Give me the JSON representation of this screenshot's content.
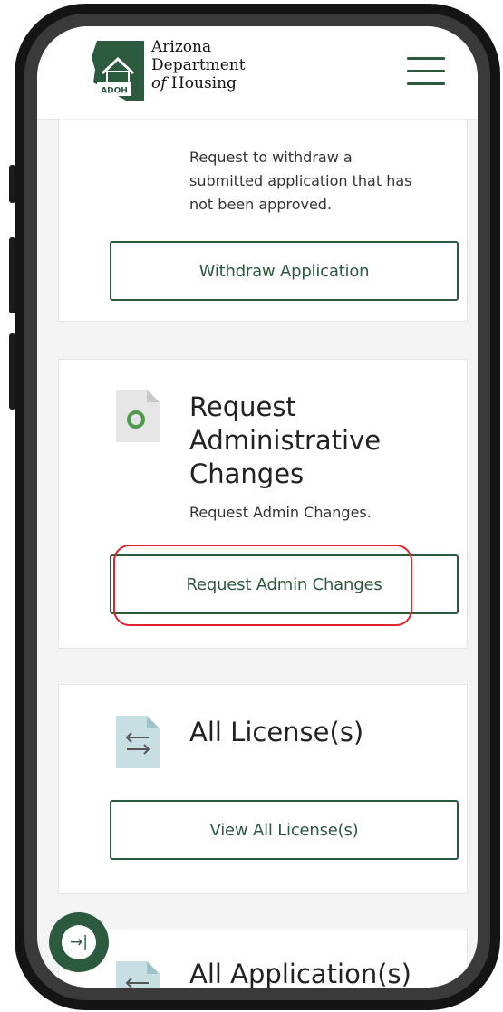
{
  "header": {
    "logo_badge": "ADOH",
    "logo_line1": "Arizona",
    "logo_line2": "Department",
    "logo_line3_italic": "of",
    "logo_line3_rest": " Housing",
    "menu_icon": "hamburger-menu-icon"
  },
  "cards": {
    "withdraw": {
      "description_lines": [
        "Request to withdraw a",
        "submitted application that has",
        "not been approved."
      ],
      "button_label": "Withdraw Application"
    },
    "admin_changes": {
      "icon": "document-circle-icon",
      "title_lines": [
        "Request",
        "Administrative",
        "Changes"
      ],
      "description": "Request Admin Changes.",
      "button_label": "Request Admin Changes"
    },
    "licenses": {
      "icon": "swap-arrows-document-icon",
      "title": "All License(s)",
      "button_label": "View All License(s)"
    },
    "applications": {
      "icon": "swap-arrows-document-icon",
      "title": "All Application(s)"
    }
  },
  "fab": {
    "icon": "collapse-arrow-icon",
    "glyph": "→|"
  },
  "colors": {
    "brand_green": "#2c5a3f",
    "highlight_red": "#e3222b",
    "page_bg": "#f4f4f4"
  }
}
